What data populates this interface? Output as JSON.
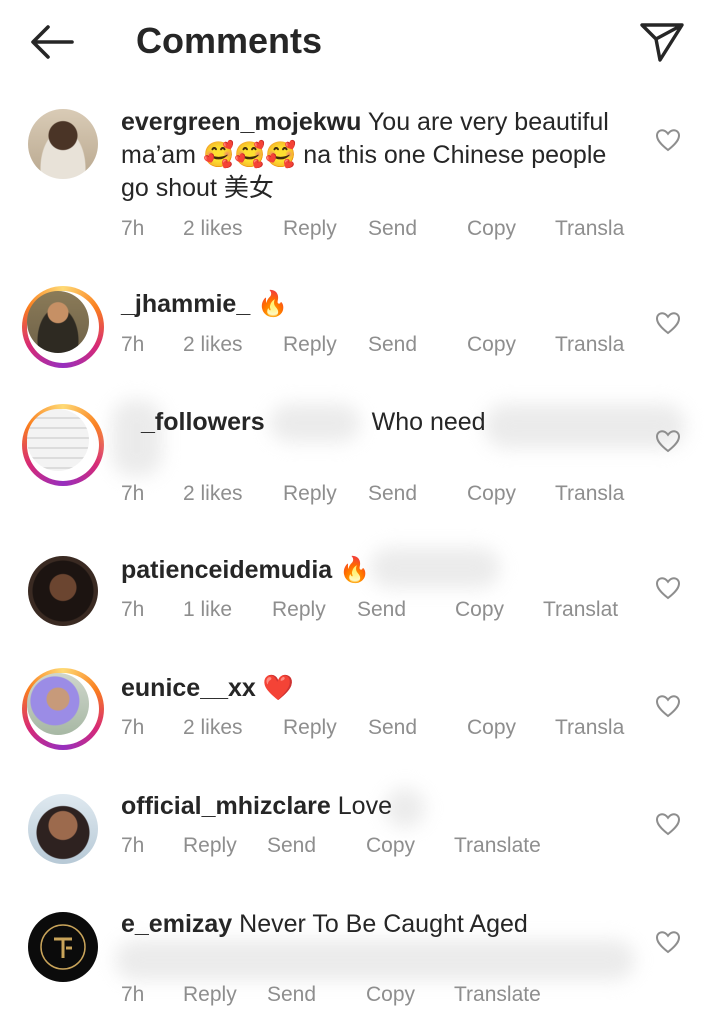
{
  "header": {
    "title": "Comments",
    "back_icon": "arrow-left-icon",
    "action_icon": "paper-plane-icon"
  },
  "comments": [
    {
      "username": "evergreen_mojekwu",
      "text": "You are very beautiful ma'am 🥰🥰🥰 na this one Chinese people go shout 美女",
      "time": "7h",
      "likes": "2 likes",
      "reply": "Reply",
      "send": "Send",
      "copy": "Copy",
      "translate": "Transla"
    },
    {
      "username": "_jhammie_",
      "text": "🔥",
      "time": "7h",
      "likes": "2 likes",
      "reply": "Reply",
      "send": "Send",
      "copy": "Copy",
      "translate": "Transla"
    },
    {
      "username": "_followers",
      "text": "Who need",
      "time": "7h",
      "likes": "2 likes",
      "reply": "Reply",
      "send": "Send",
      "copy": "Copy",
      "translate": "Transla"
    },
    {
      "username": "patienceidemudia",
      "text": "🔥",
      "time": "7h",
      "likes": "1 like",
      "reply": "Reply",
      "send": "Send",
      "copy": "Copy",
      "translate": "Translat"
    },
    {
      "username": "eunice__xx",
      "text": "❤️",
      "time": "7h",
      "likes": "2 likes",
      "reply": "Reply",
      "send": "Send",
      "copy": "Copy",
      "translate": "Transla"
    },
    {
      "username": "official_mhizclare",
      "text": "Love",
      "time": "7h",
      "reply": "Reply",
      "send": "Send",
      "copy": "Copy",
      "translate": "Translate"
    },
    {
      "username": "e_emizay",
      "text": "Never To Be Caught Aged",
      "time": "7h",
      "reply": "Reply",
      "send": "Send",
      "copy": "Copy",
      "translate": "Translate"
    }
  ],
  "colors": {
    "text": "#262626",
    "meta": "#8e8e8e",
    "like_red": "#ed4956",
    "background": "#ffffff"
  },
  "icons": {
    "like": "heart-outline-icon"
  }
}
